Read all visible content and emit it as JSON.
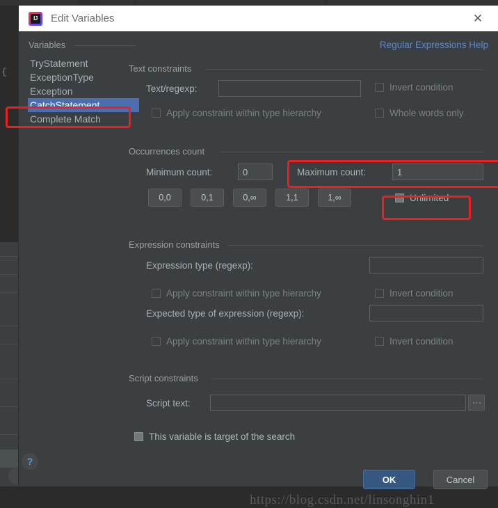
{
  "window": {
    "title": "Edit Variables",
    "app_icon": "intellij-idea-icon",
    "close_icon": "close-icon"
  },
  "links": {
    "regex_help": "Regular Expressions Help"
  },
  "variables_panel": {
    "group_label": "Variables",
    "items": [
      {
        "label": "TryStatement",
        "selected": false
      },
      {
        "label": "ExceptionType",
        "selected": false
      },
      {
        "label": "Exception",
        "selected": false
      },
      {
        "label": "CatchStatement",
        "selected": true
      },
      {
        "label": "Complete Match",
        "selected": false
      }
    ]
  },
  "text_constraints": {
    "group_label": "Text constraints",
    "text_regexp_label": "Text/regexp:",
    "text_regexp_value": "",
    "invert_condition_label": "Invert condition",
    "invert_condition_checked": false,
    "apply_hierarchy_label": "Apply constraint within type hierarchy",
    "apply_hierarchy_checked": false,
    "whole_words_label": "Whole words only",
    "whole_words_checked": false
  },
  "occurrences_count": {
    "group_label": "Occurrences count",
    "minimum_label": "Minimum count:",
    "minimum_value": "0",
    "maximum_label": "Maximum count:",
    "maximum_value": "1",
    "presets": [
      "0,0",
      "0,1",
      "0,∞",
      "1,1",
      "1,∞"
    ],
    "unlimited_label": "Unlimited",
    "unlimited_checked": false
  },
  "expression_constraints": {
    "group_label": "Expression constraints",
    "expression_type_label": "Expression type (regexp):",
    "expression_type_value": "",
    "expression_apply_hierarchy_label": "Apply constraint within type hierarchy",
    "expression_invert_label": "Invert condition",
    "expected_type_label": "Expected type of expression (regexp):",
    "expected_type_value": "",
    "expected_apply_hierarchy_label": "Apply constraint within type hierarchy",
    "expected_invert_label": "Invert condition"
  },
  "script_constraints": {
    "group_label": "Script constraints",
    "script_text_label": "Script text:",
    "script_text_value": "",
    "browse_label": "···",
    "target_of_search_label": "This variable is target of the search",
    "target_of_search_checked": false
  },
  "footer": {
    "help_label": "?",
    "ok_label": "OK",
    "cancel_label": "Cancel"
  },
  "watermark": {
    "text": "https://blog.csdn.net/linsonghin1"
  },
  "annotations": {
    "highlight_color": "#f01f1f",
    "boxes": [
      "catch-statement-list-item",
      "maximum-count-field",
      "unlimited-checkbox"
    ]
  },
  "background": {
    "code_brace": "{"
  }
}
